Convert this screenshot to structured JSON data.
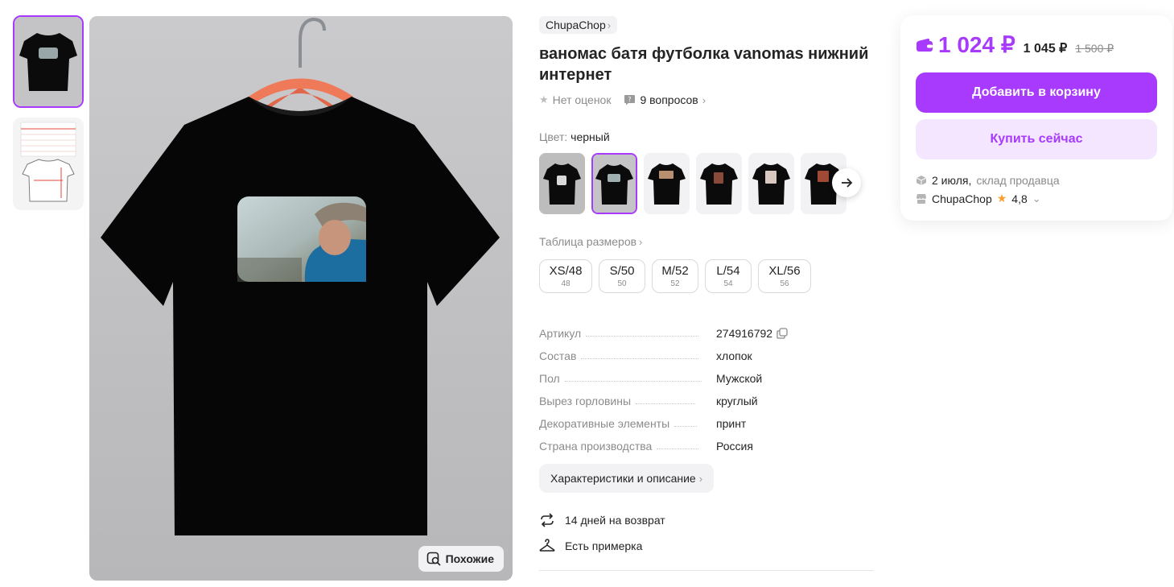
{
  "gallery": {
    "similar_label": "Похожие"
  },
  "product": {
    "brand": "ChupaChop",
    "title": "ваномас батя футболка vanomas нижний интернет",
    "rating_text": "Нет оценок",
    "questions_text": "9 вопросов",
    "color_prefix": "Цвет:",
    "color_value": "черный",
    "size_table_link": "Таблица размеров",
    "sizes": [
      {
        "label": "XS/48",
        "sub": "48"
      },
      {
        "label": "S/50",
        "sub": "50"
      },
      {
        "label": "M/52",
        "sub": "52"
      },
      {
        "label": "L/54",
        "sub": "54"
      },
      {
        "label": "XL/56",
        "sub": "56"
      }
    ],
    "specs": [
      {
        "key": "Артикул",
        "value": "274916792"
      },
      {
        "key": "Состав",
        "value": "хлопок"
      },
      {
        "key": "Пол",
        "value": "Мужской"
      },
      {
        "key": "Вырез горловины",
        "value": "круглый"
      },
      {
        "key": "Декоративные элементы",
        "value": "принт"
      },
      {
        "key": "Страна производства",
        "value": "Россия"
      }
    ],
    "description_button": "Характеристики и описание",
    "features": [
      {
        "icon": "return-arrows-icon",
        "text": "14 дней на возврат"
      },
      {
        "icon": "hanger-icon",
        "text": "Есть примерка"
      }
    ]
  },
  "price_card": {
    "price": "1 024 ₽",
    "price_without_wallet": "1 045 ₽",
    "old_price": "1 500 ₽",
    "add_to_cart": "Добавить в корзину",
    "buy_now": "Купить сейчас",
    "delivery_date": "2 июля,",
    "delivery_source": "склад продавца",
    "seller_name": "ChupaChop",
    "seller_rating": "4,8"
  },
  "colors": {
    "accent": "#a73afd",
    "accent_light": "#f3e6fe",
    "rating_star": "#ff9c2b"
  }
}
